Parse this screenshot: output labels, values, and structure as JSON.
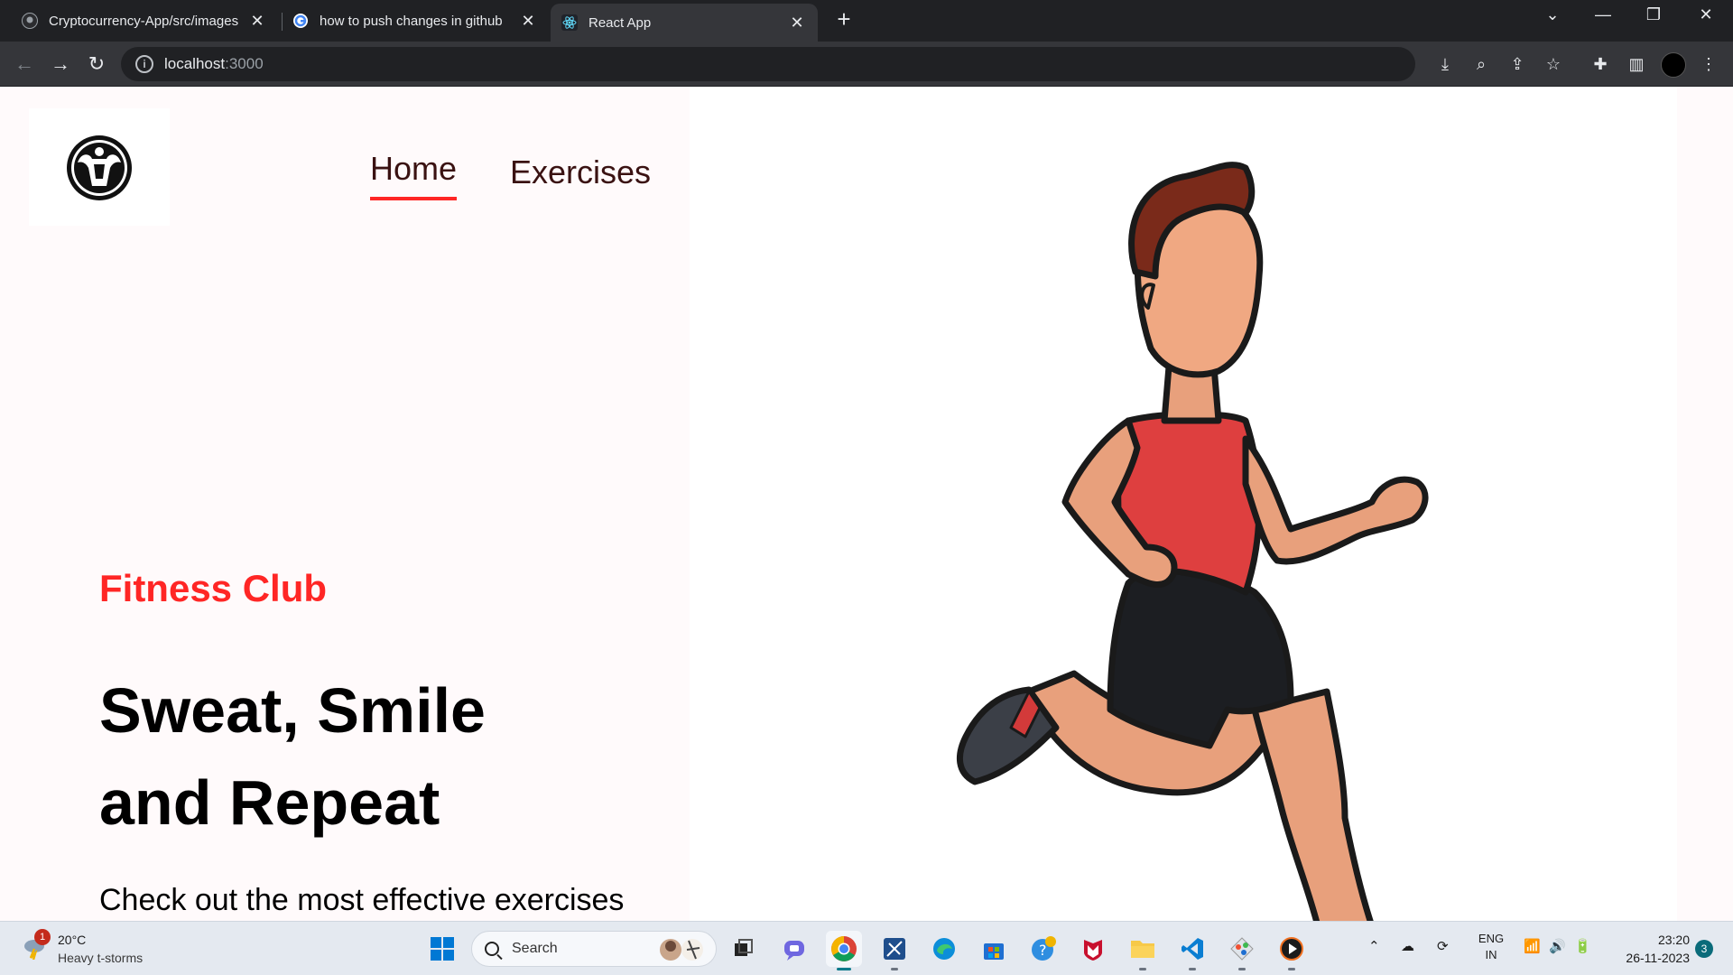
{
  "browser": {
    "tabs": [
      {
        "title": "Cryptocurrency-App/src/images",
        "icon": "github-icon"
      },
      {
        "title": "how to push changes in github",
        "icon": "google-icon"
      },
      {
        "title": "React App",
        "icon": "react-icon"
      }
    ],
    "address": {
      "host": "localhost",
      "port": ":3000"
    }
  },
  "page": {
    "nav": {
      "home": "Home",
      "exercises": "Exercises"
    },
    "hero": {
      "club": "Fitness Club",
      "headline_line1": "Sweat, Smile",
      "headline_line2": "and Repeat",
      "subtitle": "Check out the most effective exercises"
    },
    "colors": {
      "accent": "#FF2625",
      "nav_text": "#3A1212",
      "panel_bg": "#FFFAFB"
    }
  },
  "taskbar": {
    "weather": {
      "badge": "1",
      "temp": "20°C",
      "desc": "Heavy t-storms"
    },
    "search_label": "Search",
    "lang": {
      "line1": "ENG",
      "line2": "IN"
    },
    "clock": {
      "time": "23:20",
      "date": "26-11-2023"
    },
    "notifications": "3"
  }
}
